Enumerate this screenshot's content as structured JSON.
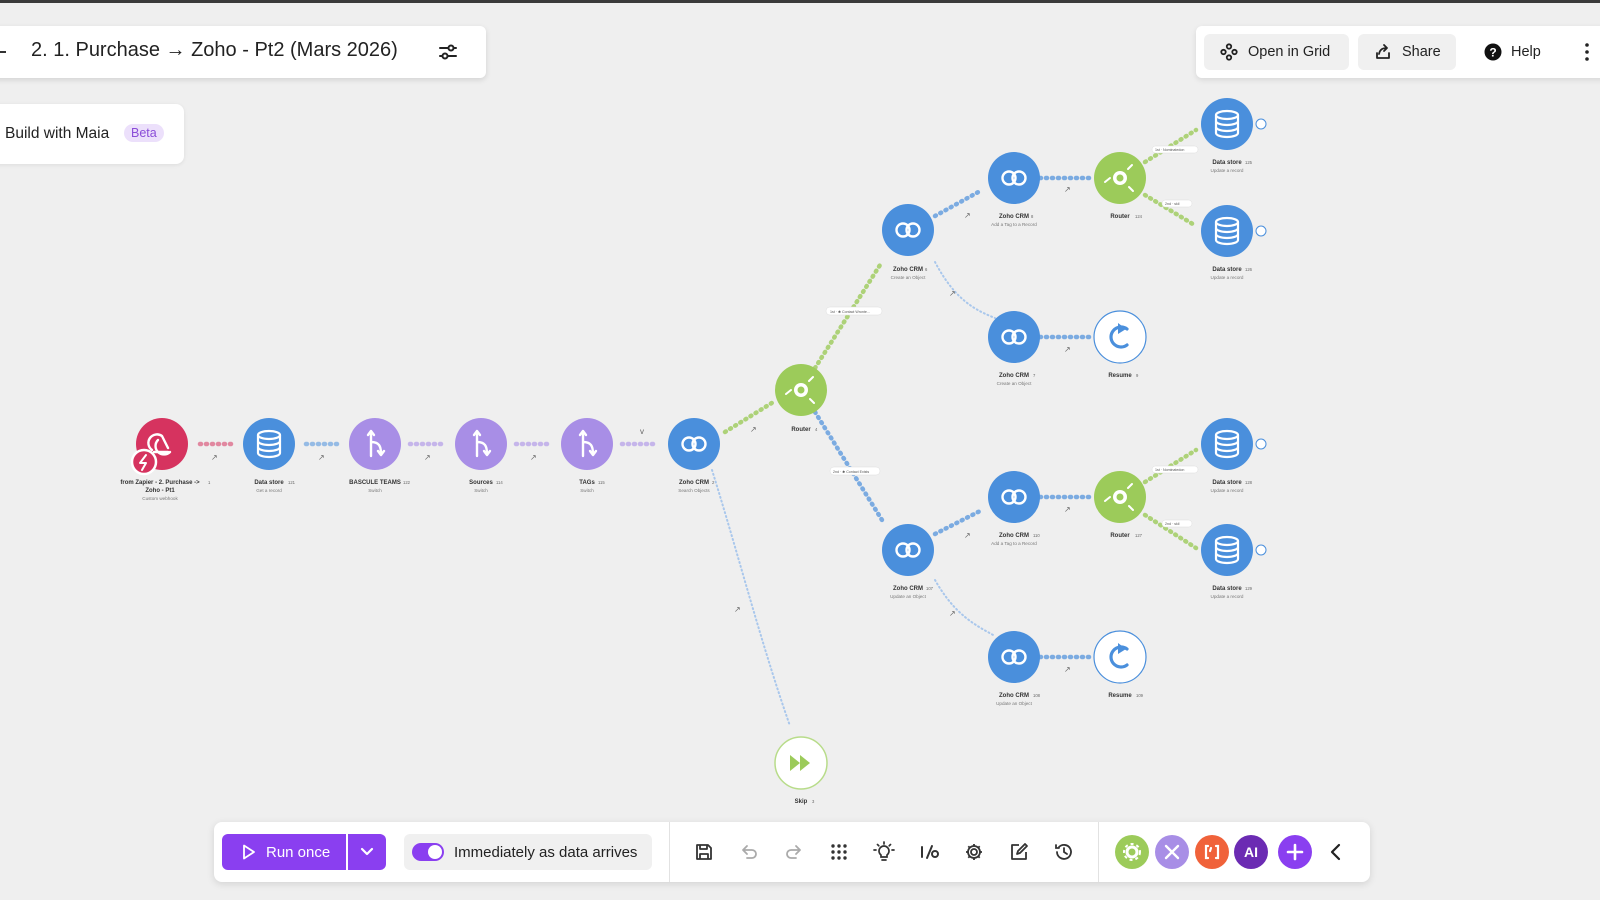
{
  "header": {
    "title": "2. 1. Purchase → Zoho - Pt2 (Mars 2026)",
    "build_with_maia": "Build with Maia",
    "beta_badge": "Beta",
    "open_in_grid": "Open in Grid",
    "share": "Share",
    "help": "Help"
  },
  "nodes": {
    "webhook": {
      "title": "from Zapier - 2. Purchase ->",
      "title2": "Zoho - Pt1",
      "id": "1",
      "sub": "Custom webhook"
    },
    "datastore_get": {
      "title": "Data store",
      "id": "121",
      "sub": "Get a record"
    },
    "bascule": {
      "title": "BASCULE TEAMS",
      "id": "122",
      "sub": "Switch"
    },
    "sources": {
      "title": "Sources",
      "id": "114",
      "sub": "Switch"
    },
    "tags": {
      "title": "TAGs",
      "id": "115",
      "sub": "Switch"
    },
    "zoho_search": {
      "title": "Zoho CRM",
      "id": "2",
      "sub": "Search Objects"
    },
    "router_main": {
      "title": "Router",
      "id": "4",
      "sub": ""
    },
    "skip": {
      "title": "Skip",
      "id": "3",
      "sub": ""
    },
    "zoho_create_top": {
      "title": "Zoho CRM",
      "id": "6",
      "sub": "Create an Object"
    },
    "zoho_tag_top": {
      "title": "Zoho CRM",
      "id": "8",
      "sub": "Add a Tag to a Record"
    },
    "router_top": {
      "title": "Router",
      "id": "124",
      "sub": ""
    },
    "ds_top1": {
      "title": "Data store",
      "id": "125",
      "sub": "Update a record"
    },
    "ds_top2": {
      "title": "Data store",
      "id": "126",
      "sub": "Update a record"
    },
    "zoho_create_mid": {
      "title": "Zoho CRM",
      "id": "7",
      "sub": "Create an Object"
    },
    "resume_top": {
      "title": "Resume",
      "id": "9",
      "sub": ""
    },
    "zoho_update_bot": {
      "title": "Zoho CRM",
      "id": "107",
      "sub": "Update an Object"
    },
    "zoho_tag_bot": {
      "title": "Zoho CRM",
      "id": "110",
      "sub": "Add a Tag to a Record"
    },
    "router_bot": {
      "title": "Router",
      "id": "127",
      "sub": ""
    },
    "ds_bot1": {
      "title": "Data store",
      "id": "128",
      "sub": "Update a record"
    },
    "ds_bot2": {
      "title": "Data store",
      "id": "129",
      "sub": "Update a record"
    },
    "zoho_update_bot2": {
      "title": "Zoho CRM",
      "id": "108",
      "sub": "Update an Object"
    },
    "resume_bot": {
      "title": "Resume",
      "id": "109",
      "sub": ""
    }
  },
  "filters": {
    "top": "1st · ✱ Contact Wronte...",
    "bottom": "2nd · ✱ Contact Exists",
    "top_r1": "1st · Nominatedon",
    "top_r2": "2nd · skil",
    "bot_r1": "1st · Nominatedon",
    "bot_r2": "2nd · skil"
  },
  "bottombar": {
    "run_once": "Run once",
    "schedule": "Immediately as data arrives",
    "ai_label": "AI"
  },
  "colors": {
    "accent": "#8a3ff0",
    "zoho_blue": "#4a8fdc",
    "router_green": "#9ccb5a",
    "switch_purple": "#a88ee6",
    "webhook_pink": "#d6335f"
  }
}
